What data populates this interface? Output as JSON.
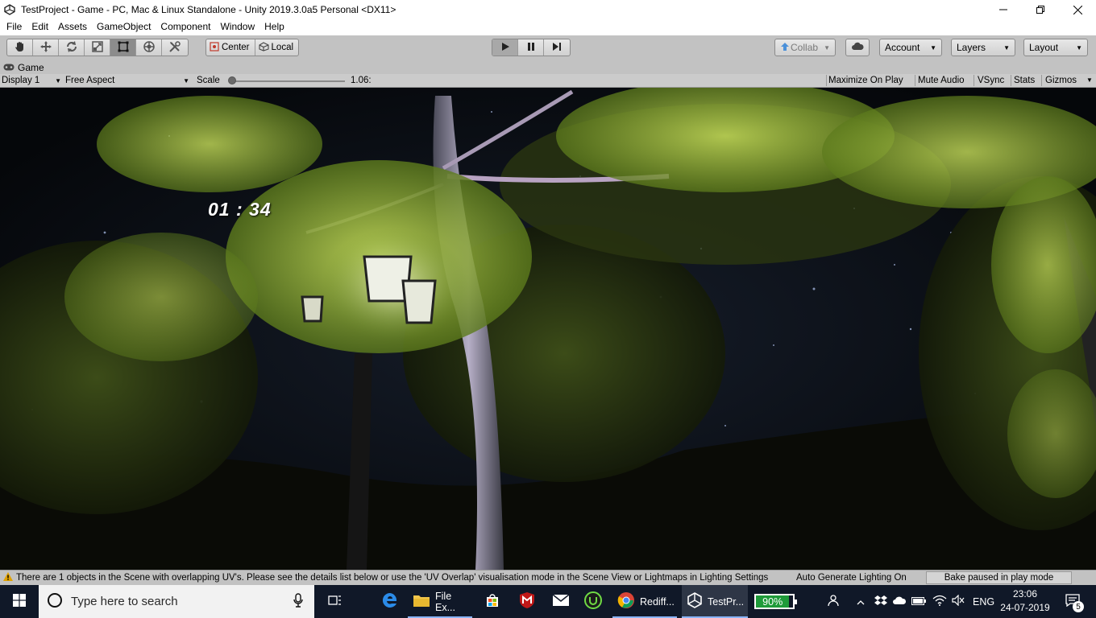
{
  "window": {
    "title": "TestProject - Game - PC, Mac & Linux Standalone - Unity 2019.3.0a5 Personal <DX11>",
    "controls": [
      "minimize",
      "maximize",
      "close"
    ]
  },
  "menu": {
    "items": [
      "File",
      "Edit",
      "Assets",
      "GameObject",
      "Component",
      "Window",
      "Help"
    ]
  },
  "toolbar": {
    "tools": [
      {
        "name": "hand-tool",
        "icon": "hand-icon"
      },
      {
        "name": "move-tool",
        "icon": "move-arrows-icon"
      },
      {
        "name": "rotate-tool",
        "icon": "rotate-icon"
      },
      {
        "name": "scale-tool",
        "icon": "scale-icon"
      },
      {
        "name": "rect-tool",
        "icon": "rect-icon"
      },
      {
        "name": "transform-tool",
        "icon": "transform-icon"
      },
      {
        "name": "custom-tool",
        "icon": "tools-icon"
      }
    ],
    "active_tool": "rect-tool",
    "pivot_mode": "Center",
    "pivot_rotation": "Local",
    "play_state": "playing",
    "collab": "Collab",
    "account": "Account",
    "layers": "Layers",
    "layout": "Layout"
  },
  "game_view": {
    "tab_label": "Game",
    "display": "Display 1",
    "aspect": "Free Aspect",
    "scale_label": "Scale",
    "scale_value": "1.06:",
    "scale_fraction": 0.0,
    "options": [
      "Maximize On Play",
      "Mute Audio",
      "VSync",
      "Stats",
      "Gizmos"
    ],
    "timer": "01 : 34"
  },
  "status": {
    "warning": "There are 1 objects in the Scene with overlapping UV's. Please see the details list below or use the 'UV Overlap' visualisation mode in the Scene View or Lightmaps in Lighting Settings",
    "auto_generate": "Auto Generate Lighting On",
    "bake": "Bake paused in play mode"
  },
  "taskbar": {
    "search_placeholder": "Type here to search",
    "apps": [
      {
        "label": "File Ex...",
        "icon": "folder-icon"
      },
      {
        "label": "Rediff...",
        "icon": "chrome-icon"
      },
      {
        "label": "TestPr...",
        "icon": "unity-icon"
      }
    ],
    "battery": "90%",
    "language": "ENG",
    "time": "23:06",
    "date": "24-07-2019",
    "notifications": "5"
  }
}
